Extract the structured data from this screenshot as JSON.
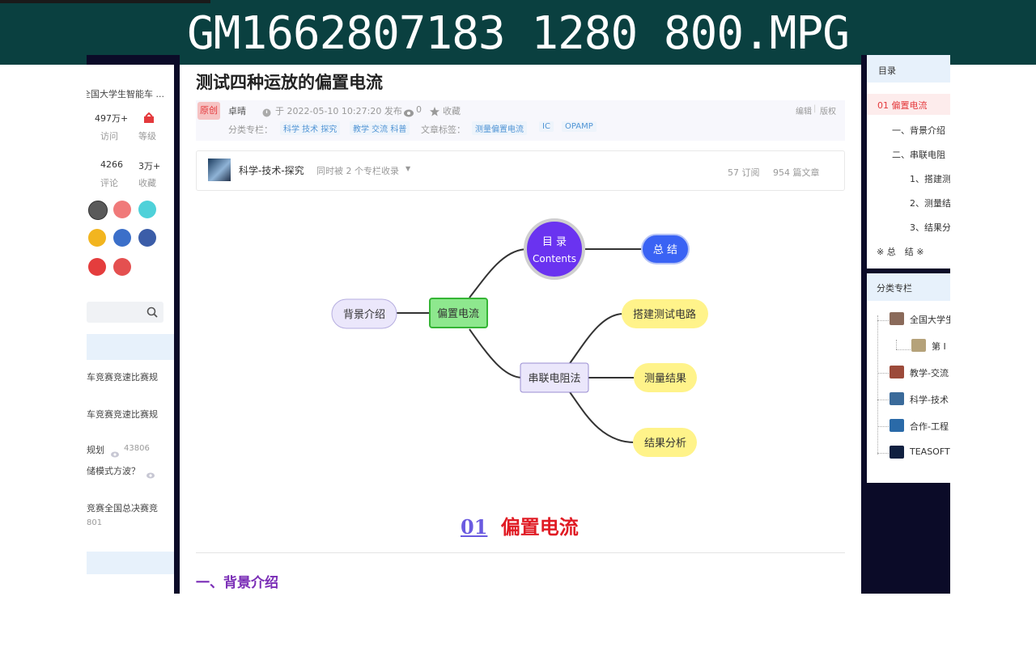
{
  "window": {
    "title": "GM1662807183 1280 800.MPG"
  },
  "left_sidebar": {
    "profile_text": "全国大学生智能车 ...",
    "stats": [
      {
        "value": "497万+",
        "label": "访问"
      },
      {
        "value": "",
        "label": "等级"
      },
      {
        "value": "4266",
        "label": "评论"
      },
      {
        "value": "3万+",
        "label": "收藏"
      }
    ],
    "links": [
      {
        "title": "车竞赛竞速比赛规"
      },
      {
        "title": "车竞赛竞速比赛规"
      },
      {
        "title": "规划",
        "views": "43806"
      },
      {
        "title": "储模式方波？"
      },
      {
        "title": "竞赛全国总决赛竞",
        "views": "801"
      }
    ]
  },
  "article": {
    "title": "测试四种运放的偏置电流",
    "original_tag": "原创",
    "author": "卓晴",
    "published": "于 2022-05-10 10:27:20 发布",
    "views": "0",
    "favorite_label": "收藏",
    "edit_label": "编辑",
    "copyright_label": "版权",
    "category_label": "分类专栏：",
    "categories": [
      "科学 技术 探究",
      "教学 交流 科普"
    ],
    "tags_label": "文章标签：",
    "tags": [
      "测量偏置电流",
      "IC",
      "OPAMP"
    ],
    "column": {
      "name": "科学-技术-探究",
      "subscribed_by": "同时被 2 个专栏收录",
      "subscriptions": "57 订阅",
      "articles": "954 篇文章"
    },
    "mindmap": {
      "center": "偏置电流",
      "left": "背景介绍",
      "toc_line1": "目 录",
      "toc_line2": "Contents",
      "summary": "总 结",
      "middle": "串联电阻法",
      "branch1": "搭建测试电路",
      "branch2": "测量结果",
      "branch3": "结果分析"
    },
    "section_number": "01",
    "section_title": "偏置电流",
    "subsection_title": "一、背景介绍"
  },
  "right_sidebar": {
    "toc_header": "目录",
    "toc_items": [
      {
        "label": "01 偏置电流"
      },
      {
        "label": "一、背景介绍"
      },
      {
        "label": "二、串联电阻"
      },
      {
        "label": "1、搭建测"
      },
      {
        "label": "2、测量结"
      },
      {
        "label": "3、结果分"
      },
      {
        "label": "※ 总　结 ※"
      }
    ],
    "columns_header": "分类专栏",
    "columns": [
      {
        "label": "全国大学生"
      },
      {
        "label": "第 I"
      },
      {
        "label": "教学-交流"
      },
      {
        "label": "科学-技术"
      },
      {
        "label": "合作-工程"
      },
      {
        "label": "TEASOFT"
      }
    ]
  },
  "colors": {
    "title_bar": "#0a4040",
    "dark_background": "#0b0b28",
    "accent_red": "#e4393c",
    "link_blue": "#5094d5",
    "heading_purple": "#7a2db6"
  }
}
